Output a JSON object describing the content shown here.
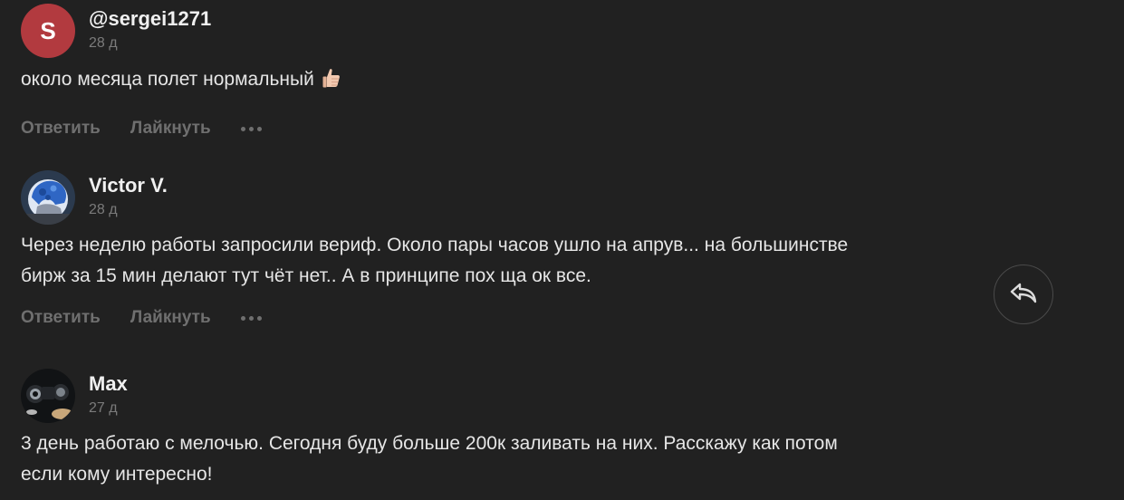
{
  "comments": [
    {
      "avatar_letter": "S",
      "avatar_color": "#b23a3f",
      "author": "@sergei1271",
      "time": "28 д",
      "text": "около месяца полет нормальный",
      "emoji": "thumbs-up-icon"
    },
    {
      "avatar_icon": "helmet-avatar",
      "author": "Victor V.",
      "time": "28 д",
      "text_lines": [
        "Через неделю работы запросили вериф. Около пары часов ушло на апрув... на большинстве",
        "бирж за 15 мин делают тут чёт нет.. А в принципе пох ща ок все."
      ]
    },
    {
      "avatar_icon": "dark-photo-avatar",
      "author": "Max",
      "time": "27 д",
      "text_lines": [
        "3 день работаю с мелочью. Сегодня буду больше 200к заливать на них. Расскажу как потом",
        "если кому интересно!"
      ]
    }
  ],
  "actions": {
    "reply": "Ответить",
    "like": "Лайкнуть",
    "more_icon": "more-dots-icon"
  },
  "floating_reply_icon": "reply-arrow-icon"
}
